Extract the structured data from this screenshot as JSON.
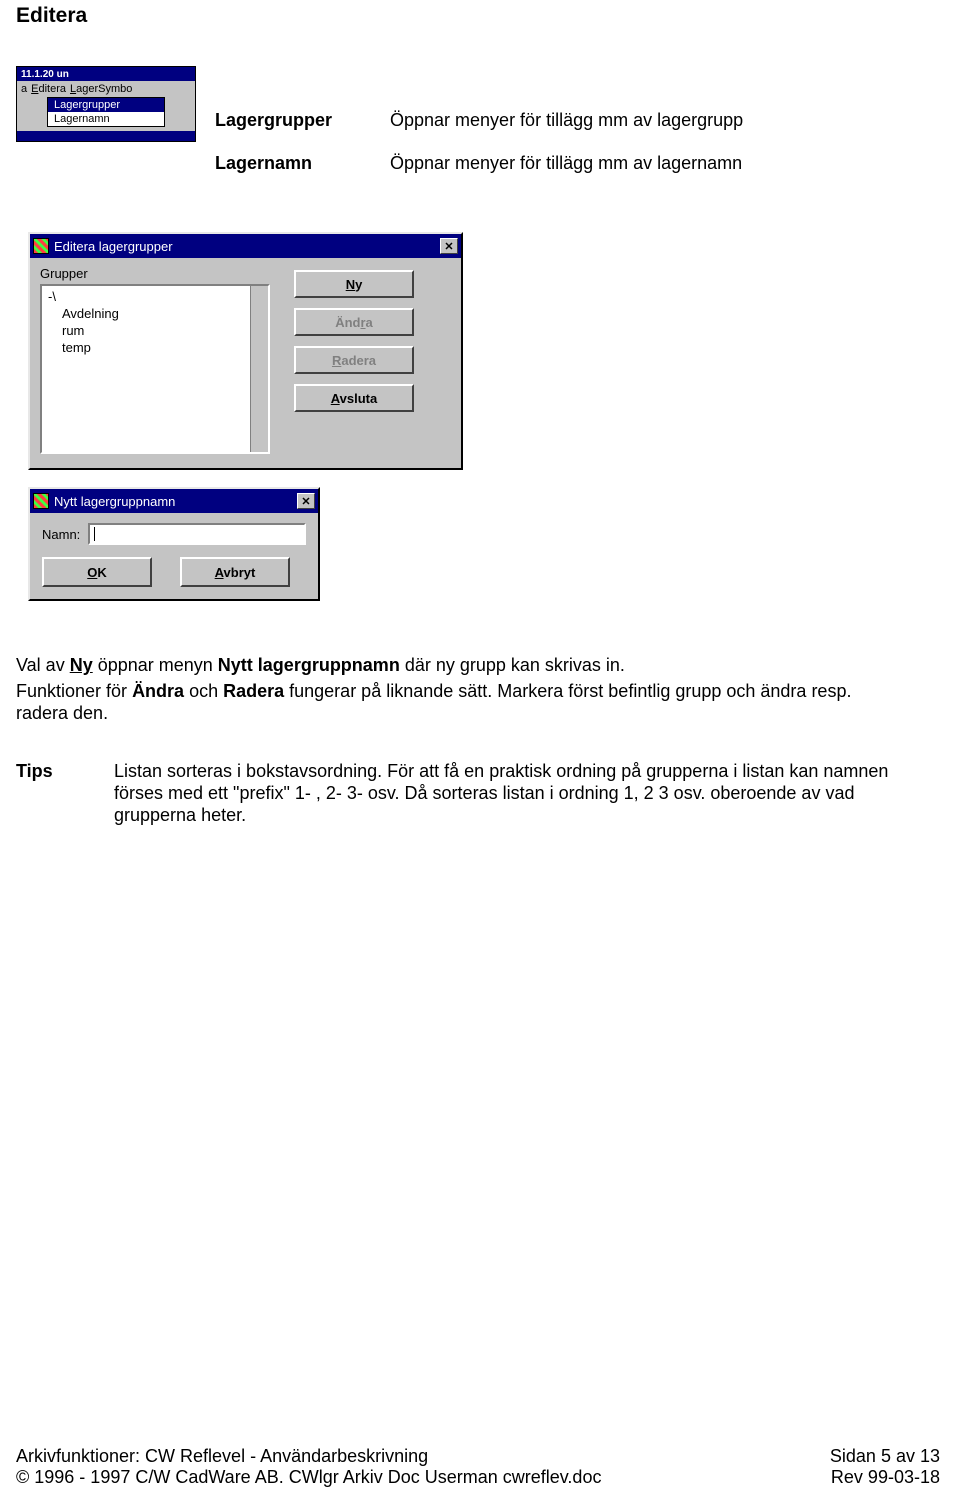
{
  "page_heading": "Editera",
  "menubar_fragment": {
    "top_label": "11.1.20    un",
    "menus": [
      "a",
      "Editera",
      "LagerSymbo"
    ],
    "menu_underlines": [
      "",
      "E",
      "L"
    ],
    "dropdown": {
      "selected": "Lagergrupper",
      "other": "Lagernamn"
    }
  },
  "definitions": [
    {
      "term": "Lagergrupper",
      "desc": "Öppnar menyer för tillägg mm av lagergrupp"
    },
    {
      "term": "Lagernamn",
      "desc": "Öppnar menyer för tillägg mm av lagernamn"
    }
  ],
  "dialog1": {
    "title": "Editera lagergrupper",
    "group_label": "Grupper",
    "list_items": [
      "-\\",
      "Avdelning",
      "rum",
      "temp"
    ],
    "buttons": {
      "ny": "Ny",
      "andra": "Ändra",
      "radera": "Radera",
      "avsluta": "Avsluta"
    }
  },
  "dialog2": {
    "title": "Nytt lagergruppnamn",
    "name_label": "Namn:",
    "ok": "OK",
    "avbryt": "Avbryt"
  },
  "paragraph": {
    "line1_pre": "Val av ",
    "line1_ny": "Ny",
    "line1_mid": " öppnar menyn ",
    "line1_bold": "Nytt lagergruppnamn",
    "line1_post": " där ny grupp kan skrivas in.",
    "line2_pre": "Funktioner för ",
    "line2_b1": "Ändra",
    "line2_mid": " och ",
    "line2_b2": "Radera",
    "line2_post": " fungerar på liknande sätt. Markera först befintlig grupp och ändra resp. radera den."
  },
  "tip": {
    "label": "Tips",
    "text": "Listan sorteras i bokstavsordning. För att få en praktisk ordning på grupperna i listan kan namnen förses med ett \"prefix\"  1- , 2- 3- osv.  Då sorteras listan i ordning 1, 2 3 osv. oberoende av vad grupperna heter."
  },
  "footer": {
    "left_line1": "Arkivfunktioner: CW Reflevel - Användarbeskrivning",
    "left_line2": "© 1996 - 1997 C/W CadWare AB. CWlgr Arkiv Doc Userman cwreflev.doc",
    "right_line1": "Sidan 5 av 13",
    "right_line2": "Rev 99-03-18"
  }
}
